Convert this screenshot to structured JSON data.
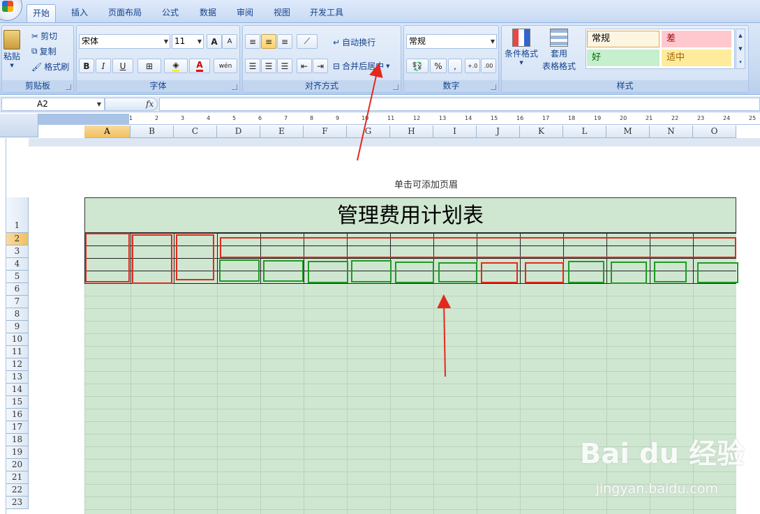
{
  "tabs": [
    "开始",
    "插入",
    "页面布局",
    "公式",
    "数据",
    "审阅",
    "视图",
    "开发工具"
  ],
  "clipboard": {
    "paste": "粘贴",
    "cut": "剪切",
    "copy": "复制",
    "format_painter": "格式刷",
    "label": "剪贴板"
  },
  "font": {
    "name": "宋体",
    "size": "11",
    "grow": "A",
    "shrink": "A",
    "bold": "B",
    "italic": "I",
    "underline": "U",
    "phonetic": "wén",
    "label": "字体"
  },
  "alignment": {
    "wrap": "自动换行",
    "merge": "合并后居中",
    "label": "对齐方式"
  },
  "number": {
    "format": "常规",
    "percent": "%",
    "comma": ",",
    "inc": "+.0",
    "dec": ".00",
    "label": "数字"
  },
  "styles": {
    "cond": "条件格式",
    "table1": "套用",
    "table2": "表格格式",
    "normal": "常规",
    "bad": "差",
    "good": "好",
    "neutral": "适中",
    "label": "样式"
  },
  "formula": {
    "namebox": "A2",
    "fx": "fx"
  },
  "columns": [
    "A",
    "B",
    "C",
    "D",
    "E",
    "F",
    "G",
    "H",
    "I",
    "J",
    "K",
    "L",
    "M",
    "N",
    "O"
  ],
  "rows": [
    "1",
    "2",
    "3",
    "4",
    "5",
    "6",
    "7",
    "8",
    "9",
    "10",
    "11",
    "12",
    "13",
    "14",
    "15",
    "16",
    "17",
    "18",
    "19",
    "20",
    "21",
    "22",
    "23"
  ],
  "ruler": [
    "1",
    "2",
    "3",
    "4",
    "5",
    "6",
    "7",
    "8",
    "9",
    "10",
    "11",
    "12",
    "13",
    "14",
    "15",
    "16",
    "17",
    "18",
    "19",
    "20",
    "21",
    "22",
    "23",
    "24",
    "25"
  ],
  "sheet": {
    "header_hint": "单击可添加页眉",
    "title": "管理费用计划表"
  },
  "watermark": {
    "logo": "Bai du 经验",
    "url": "jingyan.baidu.com"
  },
  "colors": {
    "annot_red": "#e5281e",
    "annot_green": "#1f9a26",
    "sheet_fill": "#cfe6d0"
  }
}
